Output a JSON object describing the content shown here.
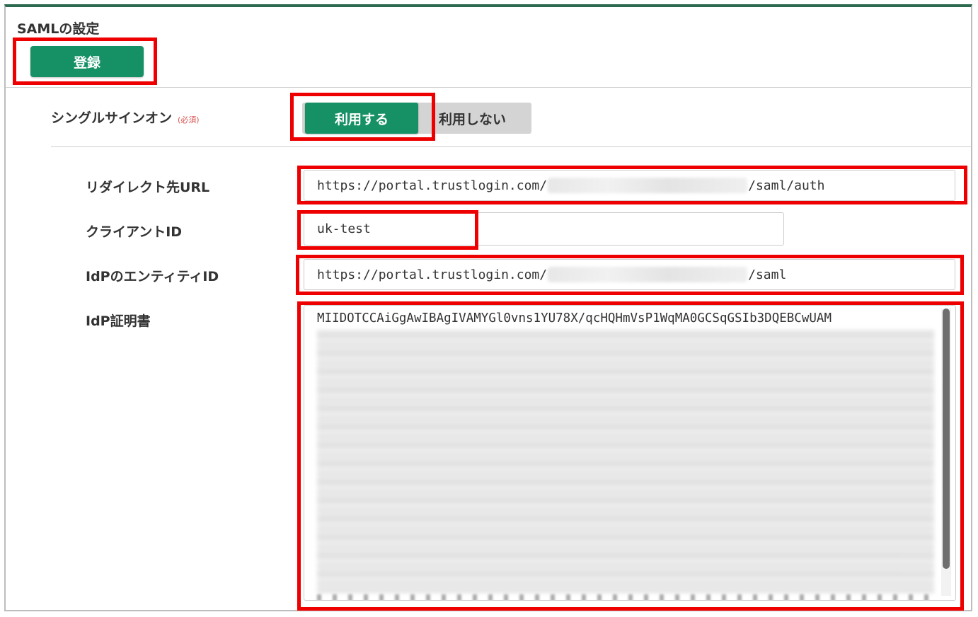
{
  "section": {
    "title": "SAMLの設定"
  },
  "toolbar": {
    "register_label": "登録"
  },
  "sso": {
    "label": "シングルサインオン",
    "required": "(必須)",
    "on_label": "利用する",
    "off_label": "利用しない",
    "selected": "利用する"
  },
  "fields": {
    "redirect_url": {
      "label": "リダイレクト先URL",
      "prefix": "https://portal.trustlogin.com/",
      "suffix": "/saml/auth"
    },
    "client_id": {
      "label": "クライアントID",
      "value": "uk-test"
    },
    "idp_entity_id": {
      "label": "IdPのエンティティID",
      "prefix": "https://portal.trustlogin.com/",
      "suffix": "/saml"
    },
    "idp_certificate": {
      "label": "IdP証明書",
      "first_line": "MIIDOTCCAiGgAwIBAgIVAMYGl0vns1YU78X/qcHQHmVsP1WqMA0GCSqGSIb3DQEBCwUAM"
    }
  },
  "colors": {
    "accent": "#169065",
    "highlight": "#ee0000",
    "header_bar": "#2b6a4f",
    "toggle_bg": "#d4d4d4"
  }
}
